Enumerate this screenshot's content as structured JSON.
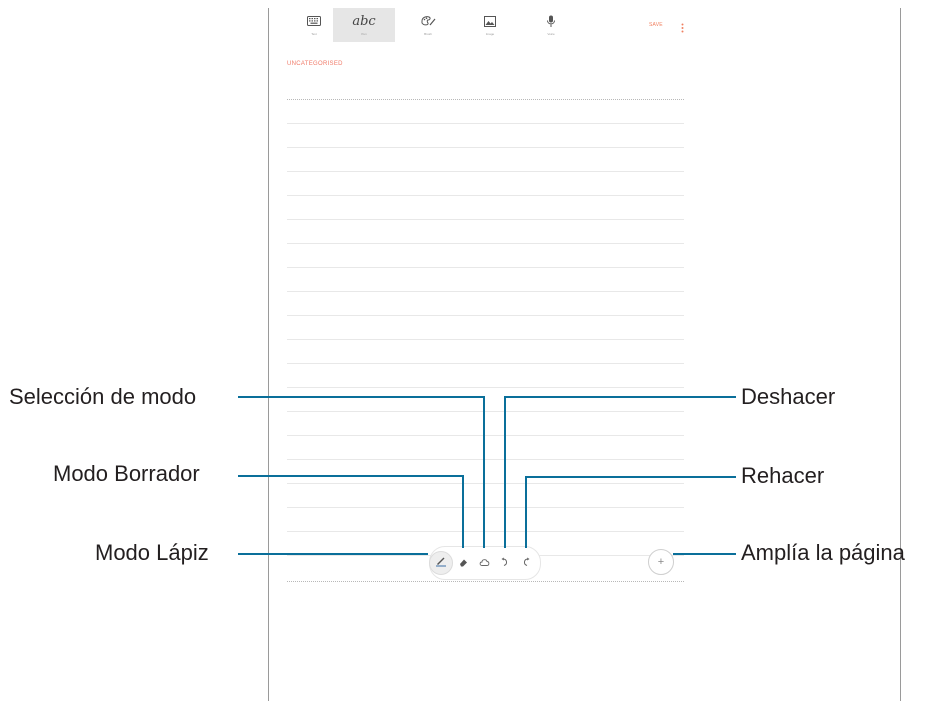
{
  "toolbar": {
    "tools": [
      {
        "icon": "keyboard-icon",
        "label": "Text"
      },
      {
        "icon": "handwriting-abc-icon",
        "glyph": "abc",
        "label": "Pen"
      },
      {
        "icon": "brush-palette-icon",
        "label": "Brush"
      },
      {
        "icon": "image-icon",
        "label": "Image"
      },
      {
        "icon": "microphone-icon",
        "label": "Voice"
      }
    ],
    "save_label": "SAVE"
  },
  "note": {
    "category": "UNCATEGORISED"
  },
  "pen_toolbar": {
    "pen_icon": "pen-mode-icon",
    "eraser_icon": "eraser-icon",
    "selection_icon": "selection-mode-icon",
    "undo_icon": "undo-icon",
    "redo_icon": "redo-icon",
    "add_page_glyph": "+"
  },
  "callouts": {
    "selection_mode": "Selección de modo",
    "eraser_mode": "Modo Borrador",
    "pen_mode": "Modo Lápiz",
    "undo": "Deshacer",
    "redo": "Rehacer",
    "expand_page": "Amplía la página"
  },
  "colors": {
    "accent": "#f07a68",
    "callout_line": "#0a6f9a"
  }
}
